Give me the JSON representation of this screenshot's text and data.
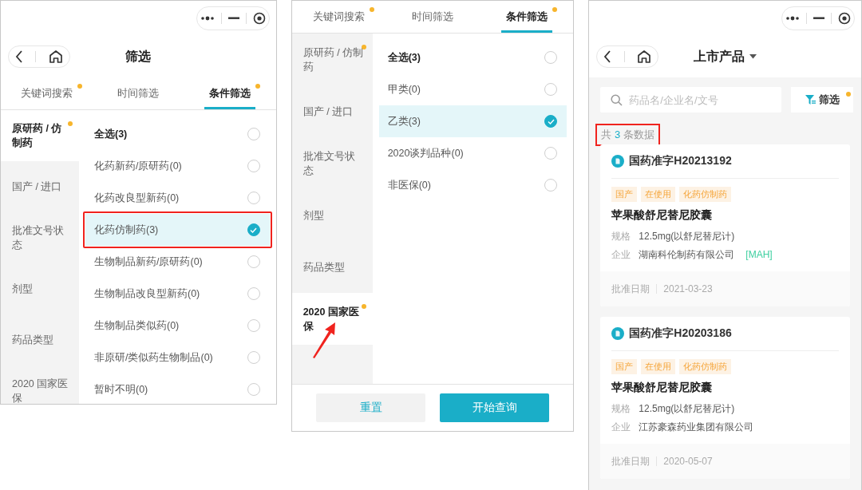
{
  "panels": [
    {
      "kind": "filter",
      "capsule": true,
      "nav": {
        "title": "筛选"
      },
      "tabs": [
        {
          "label": "关键词搜索",
          "selected": false,
          "dot": true
        },
        {
          "label": "时间筛选",
          "selected": false,
          "dot": false
        },
        {
          "label": "条件筛选",
          "selected": true,
          "dot": true
        }
      ],
      "categories": [
        {
          "label": "原研药 / 仿制药",
          "selected": true,
          "dot": true,
          "pointed": false
        },
        {
          "label": "国产 / 进口",
          "selected": false,
          "dot": false,
          "pointed": false
        },
        {
          "label": "批准文号状态",
          "selected": false,
          "dot": false,
          "pointed": false
        },
        {
          "label": "剂型",
          "selected": false,
          "dot": false,
          "pointed": false
        },
        {
          "label": "药品类型",
          "selected": false,
          "dot": false,
          "pointed": false
        },
        {
          "label": "2020 国家医保",
          "selected": false,
          "dot": false,
          "pointed": false
        }
      ],
      "options": [
        {
          "kind": "all",
          "label": "全选(3)",
          "selected": false,
          "marked": false
        },
        {
          "kind": "item",
          "label": "化药新药/原研药(0)",
          "selected": false,
          "marked": false
        },
        {
          "kind": "item",
          "label": "化药改良型新药(0)",
          "selected": false,
          "marked": false
        },
        {
          "kind": "item",
          "label": "化药仿制药(3)",
          "selected": true,
          "marked": true
        },
        {
          "kind": "item",
          "label": "生物制品新药/原研药(0)",
          "selected": false,
          "marked": false
        },
        {
          "kind": "item",
          "label": "生物制品改良型新药(0)",
          "selected": false,
          "marked": false
        },
        {
          "kind": "item",
          "label": "生物制品类似药(0)",
          "selected": false,
          "marked": false
        },
        {
          "kind": "item",
          "label": "非原研/类似药生物制品(0)",
          "selected": false,
          "marked": false
        },
        {
          "kind": "item",
          "label": "暂时不明(0)",
          "selected": false,
          "marked": false
        }
      ]
    },
    {
      "kind": "filter",
      "capsule": false,
      "tabs": [
        {
          "label": "关键词搜索",
          "selected": false,
          "dot": true
        },
        {
          "label": "时间筛选",
          "selected": false,
          "dot": false
        },
        {
          "label": "条件筛选",
          "selected": true,
          "dot": true
        }
      ],
      "categories": [
        {
          "label": "原研药 / 仿制药",
          "selected": false,
          "dot": true,
          "pointed": false
        },
        {
          "label": "国产 / 进口",
          "selected": false,
          "dot": false,
          "pointed": false
        },
        {
          "label": "批准文号状态",
          "selected": false,
          "dot": false,
          "pointed": false
        },
        {
          "label": "剂型",
          "selected": false,
          "dot": false,
          "pointed": false
        },
        {
          "label": "药品类型",
          "selected": false,
          "dot": false,
          "pointed": false
        },
        {
          "label": "2020 国家医保",
          "selected": true,
          "dot": true,
          "pointed": true
        }
      ],
      "options": [
        {
          "kind": "all",
          "label": "全选(3)",
          "selected": false,
          "marked": false
        },
        {
          "kind": "item",
          "label": "甲类(0)",
          "selected": false,
          "marked": false
        },
        {
          "kind": "item",
          "label": "乙类(3)",
          "selected": true,
          "marked": false
        },
        {
          "kind": "item",
          "label": "2020谈判品种(0)",
          "selected": false,
          "marked": false
        },
        {
          "kind": "item",
          "label": "非医保(0)",
          "selected": false,
          "marked": false
        }
      ],
      "buttons": [
        {
          "label": "重置",
          "kind": "secondary"
        },
        {
          "label": "开始查询",
          "kind": "primary"
        }
      ]
    },
    {
      "kind": "list",
      "capsule": true,
      "nav": {
        "title": "上市产品",
        "dropdown": true
      },
      "search": {
        "placeholder": "药品名/企业名/文号"
      },
      "filter_button": {
        "label": "筛选",
        "dot": true
      },
      "count": {
        "prefix": "共",
        "number": "3",
        "suffix": "条数据",
        "marked": true
      },
      "cards": [
        {
          "title": "国药准字H20213192",
          "tags": [
            "国产",
            "在使用",
            "化药仿制药"
          ],
          "name": "苹果酸舒尼替尼胶囊",
          "specs": [
            {
              "label": "规格",
              "value": "12.5mg(以舒尼替尼计)"
            },
            {
              "label": "企业",
              "value": "湖南科伦制药有限公司",
              "badge": "[MAH]"
            }
          ],
          "date_label": "批准日期",
          "date": "2021-03-23"
        },
        {
          "title": "国药准字H20203186",
          "tags": [
            "国产",
            "在使用",
            "化药仿制药"
          ],
          "name": "苹果酸舒尼替尼胶囊",
          "specs": [
            {
              "label": "规格",
              "value": "12.5mg(以舒尼替尼计)"
            },
            {
              "label": "企业",
              "value": "江苏豪森药业集团有限公司"
            }
          ],
          "date_label": "批准日期",
          "date": "2020-05-07"
        }
      ]
    }
  ]
}
